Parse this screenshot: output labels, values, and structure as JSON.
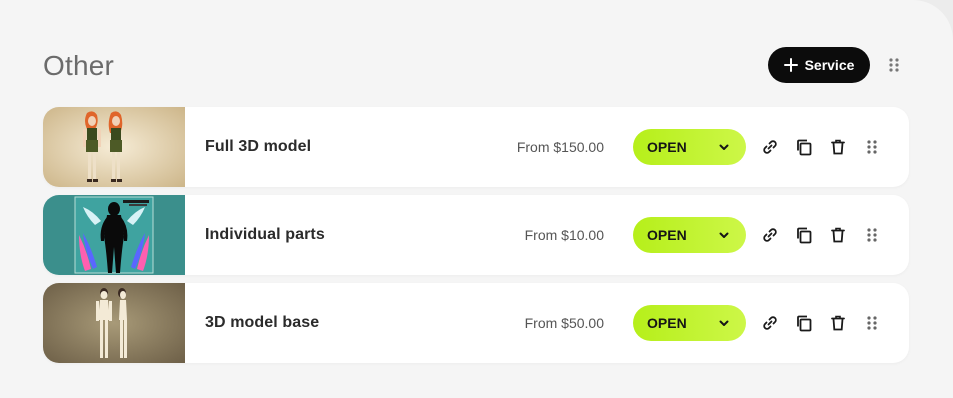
{
  "section": {
    "title": "Other",
    "add_button_label": "Service"
  },
  "services": [
    {
      "name": "Full 3D model",
      "price": "From $150.00",
      "status": "OPEN",
      "thumbnail": "character-pair-green-outfits"
    },
    {
      "name": "Individual parts",
      "price": "From $10.00",
      "status": "OPEN",
      "thumbnail": "silhouette-with-wings-reference"
    },
    {
      "name": "3D model base",
      "price": "From $50.00",
      "status": "OPEN",
      "thumbnail": "base-body-front-side"
    }
  ],
  "colors": {
    "accent": "#c1f22a",
    "button_dark": "#0c0c0c",
    "panel": "#f5f5f5",
    "card": "#ffffff"
  }
}
